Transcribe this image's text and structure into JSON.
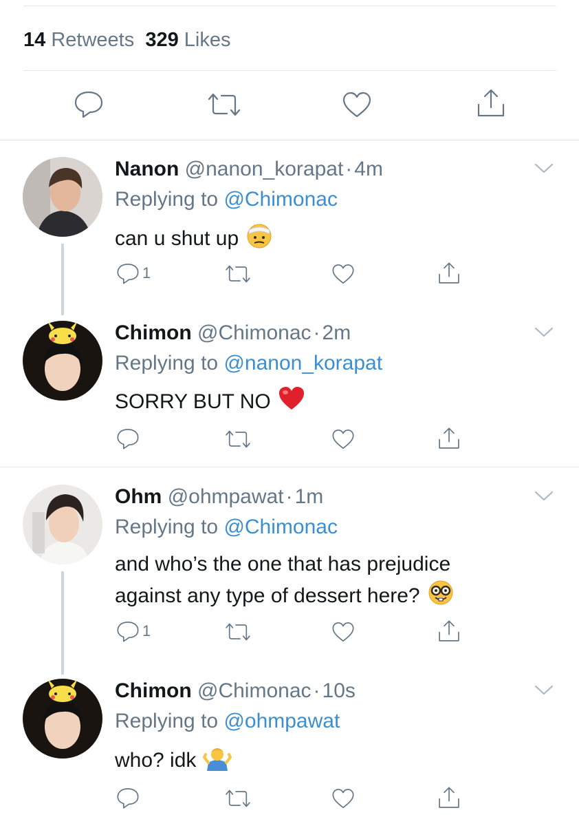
{
  "stats": {
    "retweets_count": "14",
    "retweets_label": "Retweets",
    "likes_count": "329",
    "likes_label": "Likes"
  },
  "main_actions": [
    "reply-icon",
    "retweet-icon",
    "like-icon",
    "share-icon"
  ],
  "tweets": [
    {
      "name": "Nanon",
      "handle": "@nanon_korapat",
      "time": "4m",
      "replying_prefix": "Replying to",
      "replying_to": "@Chimonac",
      "text": "can u shut up",
      "emoji": "bandage-face-emoji",
      "reply_count": "1"
    },
    {
      "name": "Chimon",
      "handle": "@Chimonac",
      "time": "2m",
      "replying_prefix": "Replying to",
      "replying_to": "@nanon_korapat",
      "text": "SORRY BUT NO",
      "emoji": "red-heart-emoji",
      "reply_count": ""
    },
    {
      "name": "Ohm",
      "handle": "@ohmpawat",
      "time": "1m",
      "replying_prefix": "Replying to",
      "replying_to": "@Chimonac",
      "text_line1": "and who’s the one that has prejudice",
      "text_line2": "against any type of dessert here?",
      "emoji": "nerd-face-emoji",
      "reply_count": "1"
    },
    {
      "name": "Chimon",
      "handle": "@Chimonac",
      "time": "10s",
      "replying_prefix": "Replying to",
      "replying_to": "@ohmpawat",
      "text": "who? idk",
      "emoji": "shrug-emoji",
      "reply_count": ""
    }
  ],
  "separator": "·",
  "colors": {
    "text": "#14171a",
    "secondary": "#657786",
    "link": "#3b8ed0",
    "divider": "#e1e8ed",
    "thread_line": "#ccd6dd"
  }
}
